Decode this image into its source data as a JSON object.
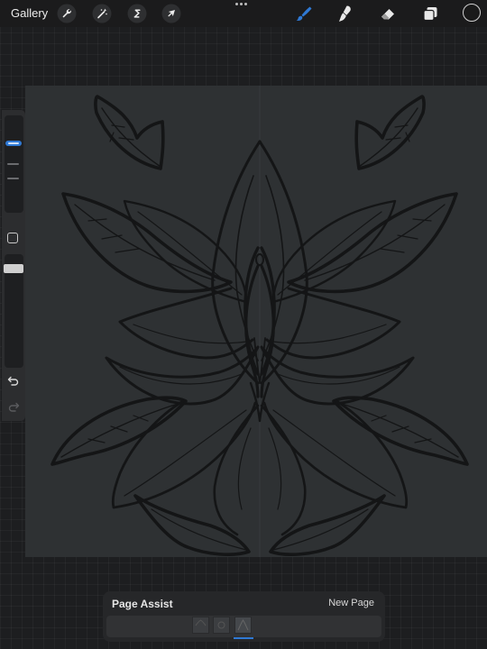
{
  "topbar": {
    "gallery_label": "Gallery",
    "left_tools": [
      {
        "icon": "wrench-icon",
        "name": "actions"
      },
      {
        "icon": "magic-wand-icon",
        "name": "adjustments"
      },
      {
        "icon": "selection-s-icon",
        "name": "selection"
      },
      {
        "icon": "arrow-cursor-icon",
        "name": "transform"
      }
    ],
    "right_tools": [
      {
        "icon": "brush-icon",
        "name": "paint",
        "active": true
      },
      {
        "icon": "smudge-icon",
        "name": "smudge"
      },
      {
        "icon": "eraser-icon",
        "name": "erase"
      },
      {
        "icon": "layers-icon",
        "name": "layers"
      }
    ],
    "active_color": "#1a1a1a",
    "accent_color": "#2f79d4"
  },
  "sidebar": {
    "controls": [
      "brush-size-slider",
      "modify-button",
      "opacity-slider",
      "undo-icon",
      "redo-icon"
    ]
  },
  "page_assist": {
    "title": "Page Assist",
    "new_page_label": "New Page",
    "page_count": 3,
    "active_page": 3
  }
}
